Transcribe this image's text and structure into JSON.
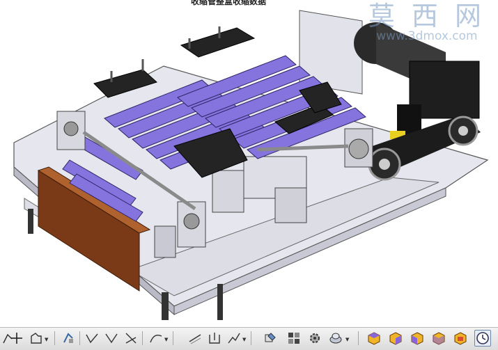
{
  "window": {
    "title": "收缩管整盒收缩数据"
  },
  "watermark": {
    "brand_chinese": "莫 西 网",
    "url": "www.3dmox.com"
  },
  "viewport": {
    "background": "#ffffff",
    "model_description_colors": {
      "plate": "#e8e8ee",
      "rollers": "#8a78e0",
      "housing": "#202020",
      "wood_panel": "#7a3a1a"
    }
  },
  "toolbar": {
    "buttons": [
      {
        "name": "arrow-icon",
        "dropdown": true
      },
      {
        "name": "plus-icon",
        "dropdown": false
      },
      {
        "name": "polygon-icon",
        "dropdown": true
      },
      {
        "name": "trim-icon",
        "dropdown": false
      },
      {
        "name": "line-v-icon",
        "dropdown": false
      },
      {
        "name": "line-v2-icon",
        "dropdown": false
      },
      {
        "name": "line-cross-icon",
        "dropdown": false
      },
      {
        "name": "curve-icon",
        "dropdown": true
      },
      {
        "name": "line-offset-icon",
        "dropdown": false
      },
      {
        "name": "bracket-icon",
        "dropdown": false
      },
      {
        "name": "dim-icon",
        "dropdown": true
      },
      {
        "name": "edit-icon",
        "dropdown": false
      },
      {
        "name": "grid-icon",
        "dropdown": false
      },
      {
        "name": "gear-icon",
        "dropdown": false
      },
      {
        "name": "shape-icon",
        "dropdown": true
      },
      {
        "name": "view-front-icon",
        "dropdown": false
      },
      {
        "name": "view-top-icon",
        "dropdown": false
      },
      {
        "name": "view-right-icon",
        "dropdown": false
      },
      {
        "name": "view-iso-icon",
        "dropdown": false
      },
      {
        "name": "view-cube-icon",
        "dropdown": false
      },
      {
        "name": "clock-icon",
        "dropdown": false,
        "selected": true
      }
    ]
  }
}
